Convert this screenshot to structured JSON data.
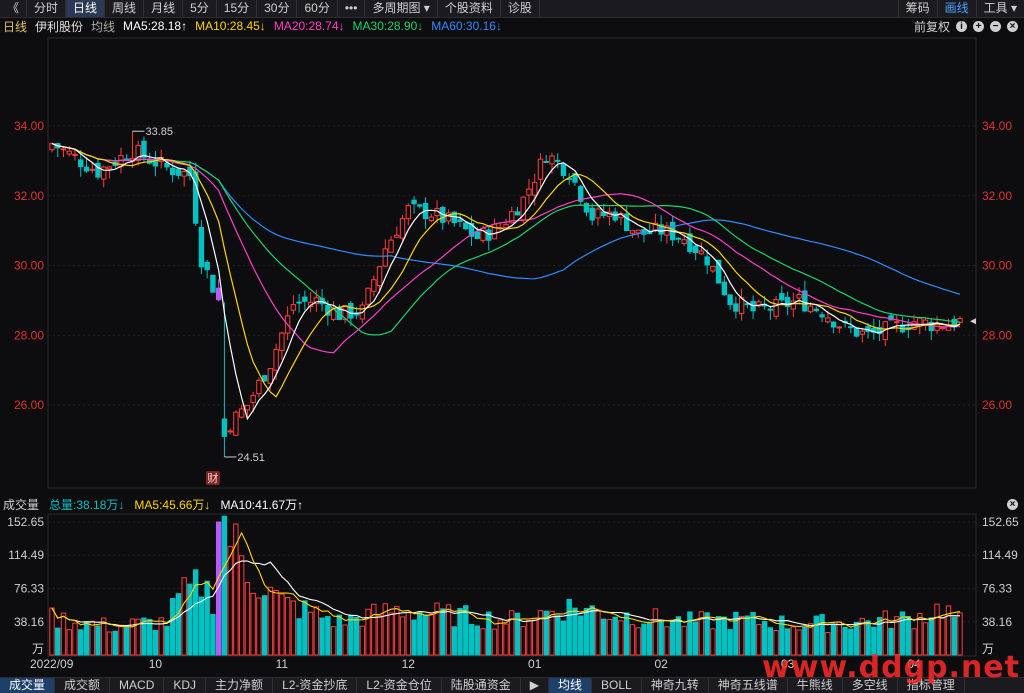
{
  "toolbar": {
    "back_label": "《",
    "tabs": [
      "分时",
      "日线",
      "周线",
      "月线",
      "5分",
      "15分",
      "30分",
      "60分",
      "•••",
      "多周期图 ▾",
      "个股资料",
      "诊股"
    ],
    "active_tab": "日线",
    "right": [
      "筹码",
      "画线",
      "工具 ▾"
    ],
    "right_active": "画线"
  },
  "header": {
    "period": "日线",
    "stock_name": "伊利股份",
    "ma_type": "均线",
    "ma5": "MA5:28.18↑",
    "ma10": "MA10:28.45↓",
    "ma20": "MA20:28.74↓",
    "ma30": "MA30:28.90↓",
    "ma60": "MA60:30.16↓",
    "adjust": "前复权",
    "info_icon": "info-icon",
    "plus_icon": "plus-icon",
    "minus_icon": "minus-icon",
    "close_icon": "close-icon"
  },
  "volume_header": {
    "label": "成交量",
    "total": "总量:38.18万↓",
    "ma5": "MA5:45.66万↓",
    "ma10": "MA10:41.67万↑"
  },
  "colors": {
    "up": "#ff3b3b",
    "down": "#00c2c2",
    "ma5": "#ffffff",
    "ma10": "#ffd400",
    "ma20": "#ff3ec8",
    "ma30": "#19d46a",
    "ma60": "#2d8cff",
    "event_bar": "#b45cff",
    "axis_label": "#e03232"
  },
  "bottom_tabs": [
    "成交量",
    "成交额",
    "MACD",
    "KDJ",
    "主力净额",
    "L2-资金抄底",
    "L2-资金仓位",
    "陆股通资金",
    "▶",
    "均线",
    "BOLL",
    "神奇九转",
    "神奇五线谱",
    "牛熊线",
    "多空线",
    "指标管理"
  ],
  "bottom_active": [
    "成交量",
    "均线"
  ],
  "watermark": "www.ddgp.net",
  "chart_data": [
    {
      "type": "candlestick",
      "title": "伊利股份 日线",
      "ylim": [
        24.3,
        35.2
      ],
      "y_ticks": [
        "34.00",
        "32.00",
        "30.00",
        "28.00",
        "26.00"
      ],
      "annotations": [
        "33.85",
        "24.51",
        "财"
      ],
      "x_ticks": [
        "2022/09",
        "10",
        "11",
        "12",
        "01",
        "02",
        "03",
        "04"
      ],
      "price_anchors": {
        "days": [
          0,
          8,
          14,
          20,
          24,
          26,
          29,
          30,
          34,
          38,
          42,
          46,
          50,
          54,
          58,
          62,
          66,
          70,
          74,
          78,
          82,
          86,
          90,
          94,
          98,
          102,
          106,
          110,
          114,
          118,
          122,
          126,
          130,
          134,
          138,
          142,
          146,
          150,
          154,
          158
        ],
        "close": [
          33.5,
          32.7,
          33.3,
          32.8,
          32.6,
          30.2,
          29.0,
          25.3,
          26.0,
          27.2,
          28.9,
          29.0,
          28.6,
          28.7,
          30.5,
          31.6,
          31.5,
          31.2,
          30.8,
          31.1,
          31.9,
          33.2,
          32.7,
          31.4,
          31.5,
          30.9,
          31.0,
          30.8,
          30.2,
          29.0,
          28.7,
          28.8,
          29.0,
          28.7,
          28.2,
          28.0,
          28.2,
          28.4,
          28.3,
          28.4
        ]
      },
      "series": [
        {
          "name": "MA5",
          "value": 28.18
        },
        {
          "name": "MA10",
          "value": 28.45
        },
        {
          "name": "MA20",
          "value": 28.74
        },
        {
          "name": "MA30",
          "value": 28.9
        },
        {
          "name": "MA60",
          "value": 30.16
        }
      ]
    },
    {
      "type": "bar",
      "title": "成交量",
      "ylim": [
        0,
        152.65
      ],
      "y_ticks": [
        "152.65",
        "114.49",
        "76.33",
        "38.16",
        "万"
      ],
      "volume_anchors": {
        "days": [
          0,
          10,
          20,
          22,
          26,
          28,
          29,
          30,
          34,
          40,
          50,
          60,
          70,
          80,
          90,
          100,
          110,
          120,
          130,
          140,
          150,
          155,
          158
        ],
        "volume": [
          42,
          33,
          38,
          65,
          82,
          65,
          78,
          152,
          95,
          60,
          38,
          52,
          45,
          40,
          55,
          45,
          38,
          40,
          35,
          38,
          42,
          55,
          38
        ]
      }
    }
  ]
}
